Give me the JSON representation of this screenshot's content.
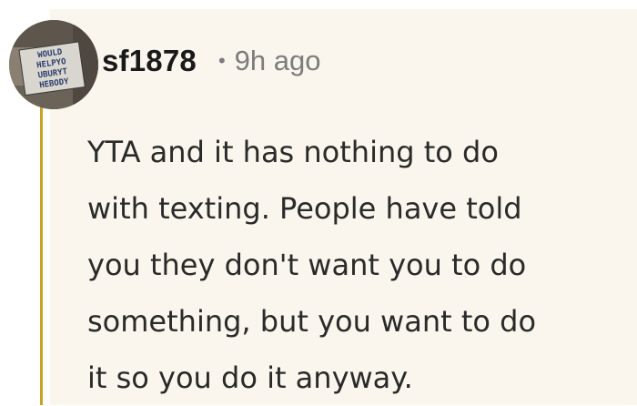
{
  "comment": {
    "avatar_text": "WOULD HELPYO UBURYT HEBODY",
    "username": "sf1878",
    "separator": "•",
    "timestamp": "9h ago",
    "body": "YTA and it has nothing to do\nwith texting. People have told\nyou they don't want you to do\nsomething, but you want to do\nit so you do it anyway."
  },
  "colors": {
    "thread_line": "#c9a227",
    "panel_background": "#faf6ed",
    "username": "#1a1a1b",
    "meta": "#7c7c7c"
  },
  "icons": {
    "avatar": "user-avatar-letter-blocks"
  }
}
